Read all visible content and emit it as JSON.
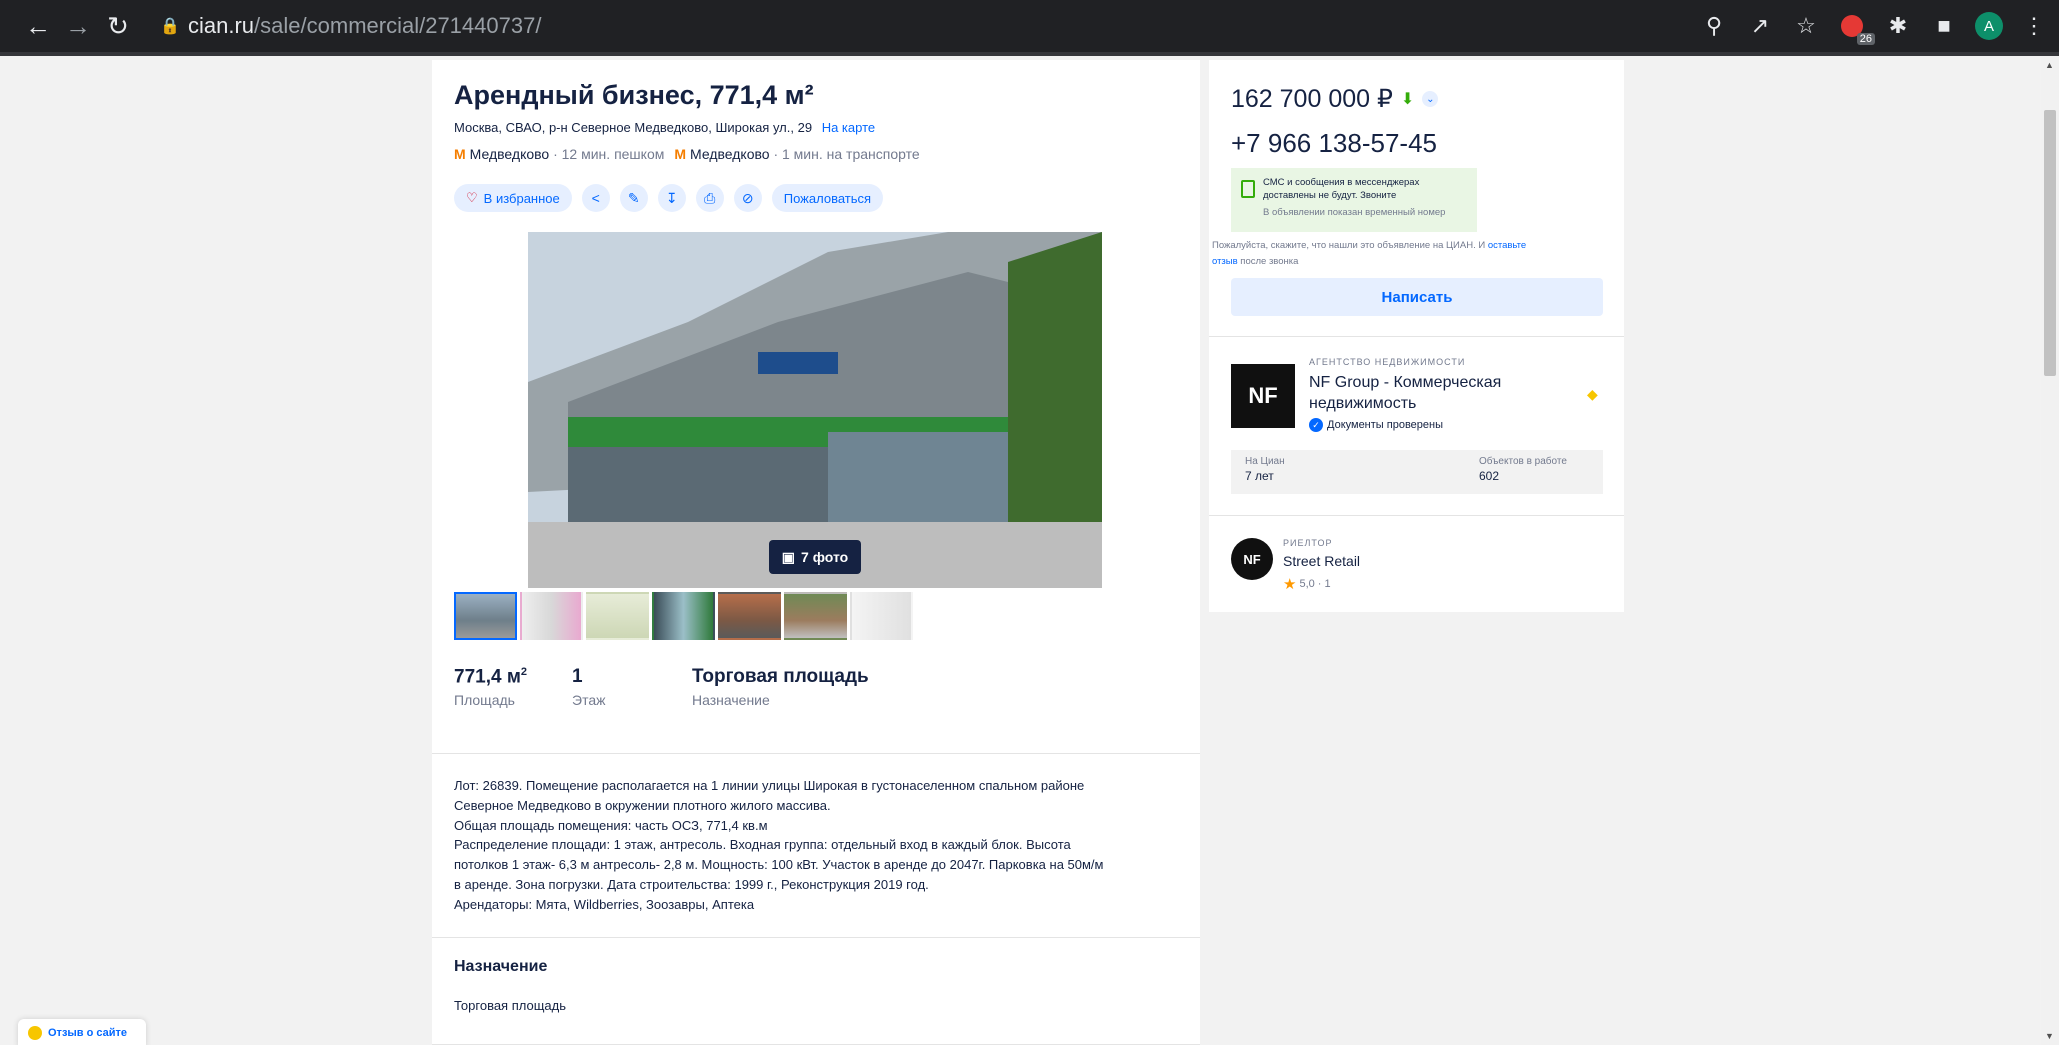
{
  "browser": {
    "url_host": "cian.ru",
    "url_path": "/sale/commercial/271440737/",
    "extension_badge": "26",
    "profile_initial": "A"
  },
  "listing": {
    "title": "Арендный бизнес, 771,4 м²",
    "address": "Москва, СВАО, р-н Северное Медведково, Широкая ул., 29",
    "map_link": "На карте",
    "metro": [
      {
        "name": "Медведково",
        "time": "· 12 мин. пешком"
      },
      {
        "name": "Медведково",
        "time": "· 1 мин. на транспорте"
      }
    ],
    "favorite_label": "В избранное",
    "complain_label": "Пожаловаться",
    "photo_count": "7 фото",
    "thumbnail_count": 7,
    "facts": [
      {
        "value": "771,4 м",
        "sup": "2",
        "label": "Площадь"
      },
      {
        "value": "1",
        "sup": "",
        "label": "Этаж"
      },
      {
        "value": "Торговая площадь",
        "sup": "",
        "label": "Назначение"
      }
    ],
    "description_lines": [
      "Лот: 26839. Помещение располагается на 1 линии улицы Широкая в густонаселенном спальном районе",
      "Северное Медведково в окружении плотного жилого массива.",
      "Общая площадь помещения: часть ОСЗ, 771,4 кв.м",
      "Распределение площади: 1 этаж, антресоль. Входная группа: отдельный вход в каждый блок. Высота",
      "потолков 1 этаж- 6,3 м антресоль- 2,8 м. Мощность: 100 кВт. Участок в аренде до 2047г. Парковка на 50м/м",
      "в аренде. Зона погрузки. Дата строительства: 1999 г., Реконструкция 2019 год.",
      "Арендаторы: Мята, Wildberries, Зоозавры, Аптека"
    ],
    "purpose_title": "Назначение",
    "purpose_value": "Торговая площадь"
  },
  "sidebar": {
    "price": "162 700 000 ₽",
    "phone": "+7 966 138-57-45",
    "notice_line1": "СМС и сообщения в мессенджерах",
    "notice_line2": "доставлены не будут. Звоните",
    "notice_sub": "В объявлении показан временный номер",
    "ask_text": "Пожалуйста, скажите, что нашли это объявление на ЦИАН. И ",
    "ask_link1": "оставьте",
    "ask_link2": "отзыв",
    "ask_tail": " после звонка",
    "write_label": "Написать",
    "agency_type": "АГЕНТСТВО НЕДВИЖИМОСТИ",
    "agency_name": "NF Group - Коммерческая недвижимость",
    "agency_logo": "NF",
    "verified_label": "Документы проверены",
    "stat1_label": "На Циан",
    "stat1_value": "7 лет",
    "stat2_label": "Объектов в работе",
    "stat2_value": "602",
    "realtor_type": "РИЕЛТОР",
    "realtor_name": "Street Retail",
    "realtor_logo": "NF",
    "realtor_rating": "5,0 · 1"
  },
  "feedback_label": "Отзыв о сайте",
  "colors": {
    "accent": "#0468ff",
    "text": "#152242",
    "metro": "#f57e00",
    "price_down": "#34ac0a"
  }
}
